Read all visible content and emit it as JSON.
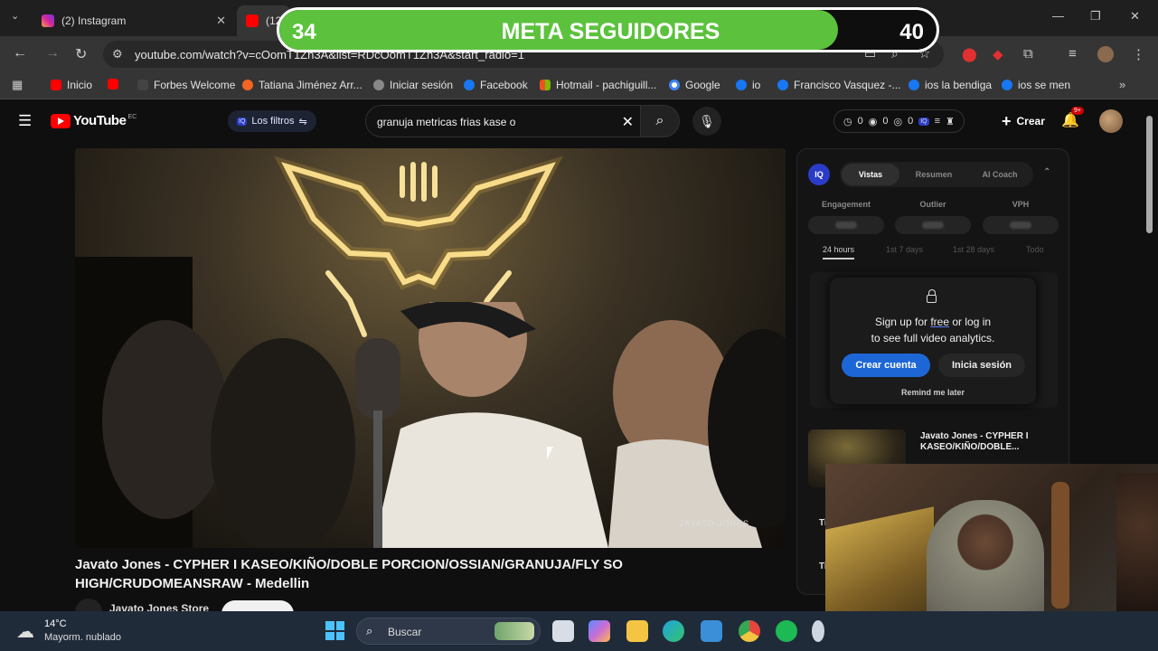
{
  "browser": {
    "tabs": [
      {
        "title": "(2) Instagram",
        "close": "✕",
        "icon_color": "#d6249f"
      },
      {
        "title": "(12",
        "icon_color": "#ff0000"
      }
    ],
    "url": "youtube.com/watch?v=cOomT1Zn3A&list=RDcOomT1Zn3A&start_radio=1",
    "window_controls": {
      "minimize": "—",
      "maximize": "❐",
      "close": "✕"
    }
  },
  "goal_overlay": {
    "current": "34",
    "title": "META SEGUIDORES",
    "target": "40",
    "progress": 0.85,
    "fill_color": "#5cc23d"
  },
  "bookmarks": [
    {
      "label": "Inicio",
      "color": "#ff0000"
    },
    {
      "label": "",
      "color": "#ff0000"
    },
    {
      "label": "Forbes Welcome",
      "color": "#444444"
    },
    {
      "label": "Tatiana Jiménez Arr...",
      "color": "#f26522"
    },
    {
      "label": "Iniciar sesión",
      "color": "#888888"
    },
    {
      "label": "Facebook",
      "color": "#1877f2"
    },
    {
      "label": "Hotmail - pachiguill...",
      "color": "#f25022"
    },
    {
      "label": "Google",
      "color": "#4285f4"
    },
    {
      "label": "io",
      "color": "#1877f2"
    },
    {
      "label": "Francisco Vasquez -...",
      "color": "#1877f2"
    },
    {
      "label": "ios la bendiga",
      "color": "#1877f2"
    },
    {
      "label": "ios se men",
      "color": "#1877f2"
    }
  ],
  "youtube": {
    "logo": "YouTube",
    "country": "EC",
    "filters_label": "Los filtros",
    "search_query": "granuja metricas frias kase o",
    "stats": [
      "0",
      "0",
      "0"
    ],
    "create_label": "Crear",
    "notif_badge": "9+"
  },
  "video": {
    "watermark": "JAVATO JONES",
    "title": "Javato Jones - CYPHER I KASEO/KIÑO/DOBLE PORCION/OSSIAN/GRANUJA/FLY SO HIGH/CRUDOMEANSRAW - Medellin",
    "channel": "Javato Jones Store"
  },
  "analytics_panel": {
    "logo": "IQ",
    "tabs": [
      "Vistas",
      "Resumen",
      "AI Coach"
    ],
    "metrics": [
      "Engagement",
      "Outlier",
      "VPH"
    ],
    "ranges": [
      "24 hours",
      "1st 7 days",
      "1st 28 days",
      "Todo"
    ],
    "modal": {
      "line1_pre": "Sign up for ",
      "line1_link": "free",
      "line1_post": " or log in",
      "line2": "to see full video analytics.",
      "create_btn": "Crear cuenta",
      "login_btn": "Inicia sesión",
      "remind": "Remind me later"
    },
    "recommended": {
      "title": "Javato Jones - CYPHER I KASEO/KIÑO/DOBLE..."
    },
    "row_marks": [
      "Ti",
      "Ti"
    ]
  },
  "taskbar": {
    "temperature": "14°C",
    "condition": "Mayorm. nublado",
    "search_label": "Buscar",
    "apps": [
      {
        "name": "task-view",
        "color": "#d8dde6"
      },
      {
        "name": "copilot",
        "color": "#c86dd7"
      },
      {
        "name": "file-explorer",
        "color": "#f4c542"
      },
      {
        "name": "edge",
        "color": "#1fa3e0"
      },
      {
        "name": "store",
        "color": "#3a8fd8"
      },
      {
        "name": "chrome",
        "color": "#e8453c"
      },
      {
        "name": "spotify",
        "color": "#1db954"
      }
    ]
  }
}
